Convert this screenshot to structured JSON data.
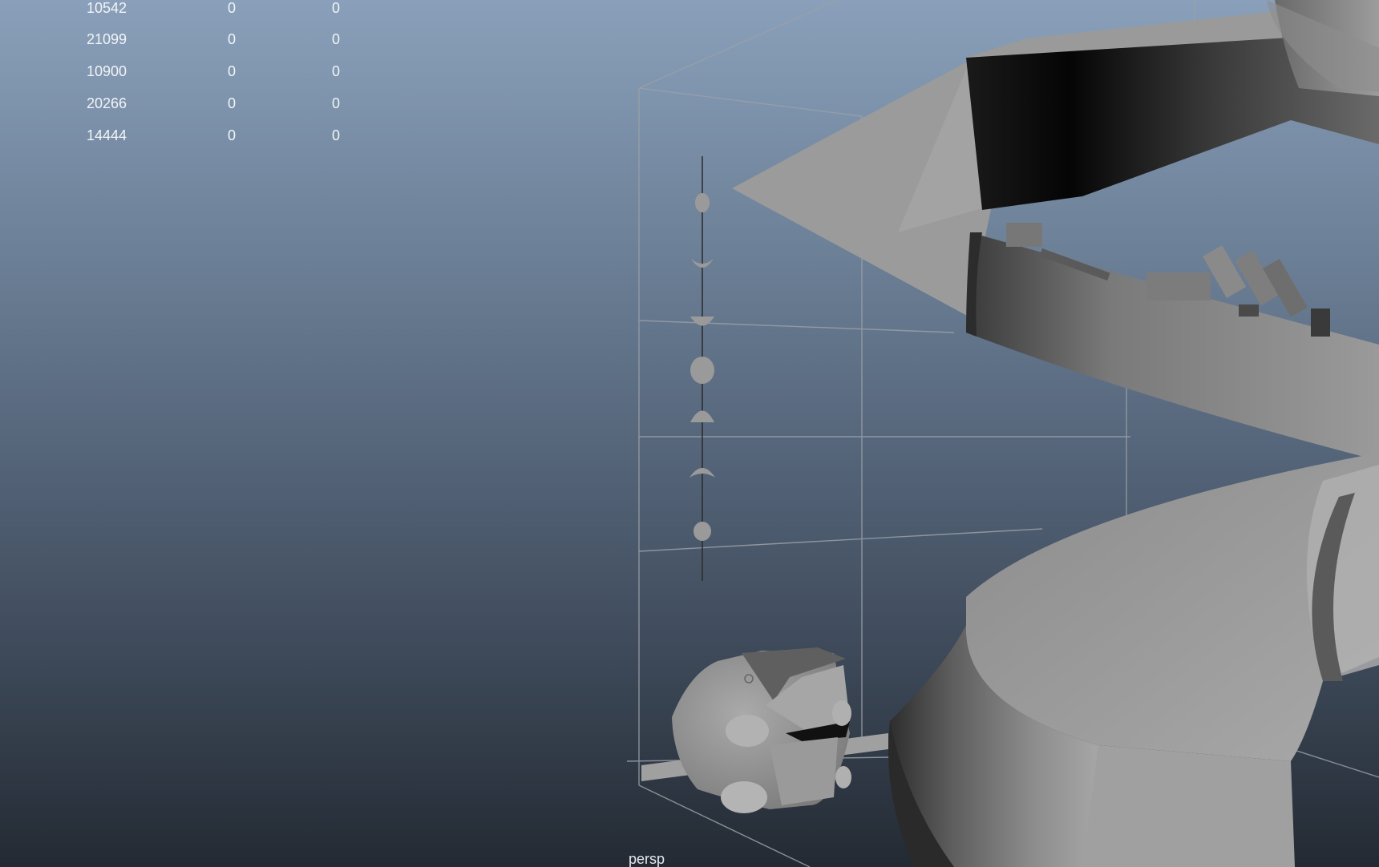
{
  "viewport": {
    "camera_label": "persp",
    "background_top": "#8aa0ba",
    "background_bottom": "#232a33"
  },
  "hud": {
    "rows": [
      {
        "count": "10542",
        "col2": "0",
        "col3": "0"
      },
      {
        "count": "21099",
        "col2": "0",
        "col3": "0"
      },
      {
        "count": "10900",
        "col2": "0",
        "col3": "0"
      },
      {
        "count": "20266",
        "col2": "0",
        "col3": "0"
      },
      {
        "count": "14444",
        "col2": "0",
        "col3": "0"
      }
    ]
  }
}
